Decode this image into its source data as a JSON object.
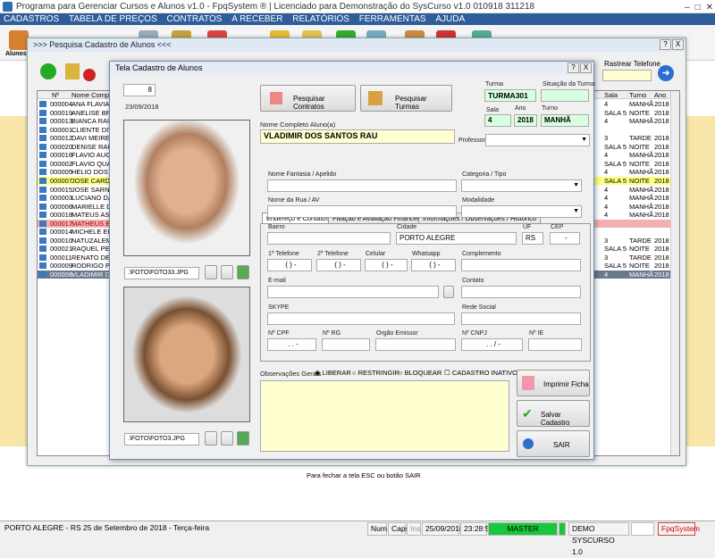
{
  "app": {
    "title": "Programa para Gerenciar Cursos e Alunos v1.0 - FpqSystem ® | Licenciado para Demonstração do SysCurso v1.0 010918 311218"
  },
  "menu": [
    "CADASTROS",
    "TABELA DE PREÇOS",
    "CONTRATOS",
    "A RECEBER",
    "RELATÓRIOS",
    "FERRAMENTAS",
    "AJUDA"
  ],
  "toolbar": {
    "alunos_label": "Alunos"
  },
  "search_window": {
    "title": ">>> Pesquisa Cadastro de Alunos <<<",
    "rastrear_label": "Rastrear Telefone",
    "help": "?",
    "close": "X",
    "col_no": "Nº",
    "col_nome": "Nome Completo",
    "col_sala": "Sala",
    "col_turno": "Turno",
    "col_ano": "Ano",
    "rows": [
      {
        "n": "000004",
        "nome": "ANA FLAVIA ME",
        "sala": "4",
        "turno": "MANHÃ",
        "ano": "2018"
      },
      {
        "n": "000019",
        "nome": "ANELISE BRAND",
        "sala": "SALA 5",
        "turno": "NOITE",
        "ano": "2018"
      },
      {
        "n": "000013",
        "nome": "BIANCA RAU",
        "sala": "4",
        "turno": "MANHÃ",
        "ano": "2018"
      },
      {
        "n": "000001",
        "nome": "CLIENTE DIVERS",
        "sala": "",
        "turno": "",
        "ano": ""
      },
      {
        "n": "000012",
        "nome": "DAVI MEIRELLE",
        "sala": "3",
        "turno": "TARDE",
        "ano": "2018"
      },
      {
        "n": "000020",
        "nome": "DENISE RAU DO",
        "sala": "SALA 5",
        "turno": "NOITE",
        "ano": "2018"
      },
      {
        "n": "000016",
        "nome": "FLAVIO AUGUST",
        "sala": "4",
        "turno": "MANHÃ",
        "ano": "2018"
      },
      {
        "n": "000002",
        "nome": "FLAVIO QUADRA",
        "sala": "SALA 5",
        "turno": "NOITE",
        "ano": "2018"
      },
      {
        "n": "000005",
        "nome": "HELIO DOS SAN",
        "sala": "4",
        "turno": "MANHÃ",
        "ano": "2018"
      },
      {
        "n": "000007",
        "nome": "JOSE CARDOSO",
        "sala": "SALA 5",
        "turno": "NOITE",
        "ano": "2018"
      },
      {
        "n": "000015",
        "nome": "JOSE SARNEY",
        "sala": "4",
        "turno": "MANHÃ",
        "ano": "2018"
      },
      {
        "n": "000003",
        "nome": "LUCIANO DA SIL",
        "sala": "4",
        "turno": "MANHÃ",
        "ano": "2018"
      },
      {
        "n": "000006",
        "nome": "MARIELLE DA S",
        "sala": "4",
        "turno": "MANHÃ",
        "ano": "2018"
      },
      {
        "n": "000018",
        "nome": "MATEUS ASSIS",
        "sala": "4",
        "turno": "MANHÃ",
        "ano": "2018"
      },
      {
        "n": "000017",
        "nome": "MATHEUS EILOF",
        "sala": "",
        "turno": "",
        "ano": ""
      },
      {
        "n": "000014",
        "nome": "MICHELE EILOF",
        "sala": "",
        "turno": "",
        "ano": ""
      },
      {
        "n": "000010",
        "nome": "NATUZALEM DE",
        "sala": "3",
        "turno": "TARDE",
        "ano": "2018"
      },
      {
        "n": "000021",
        "nome": "RAQUEL PEREIR",
        "sala": "SALA 5",
        "turno": "NOITE",
        "ano": "2018"
      },
      {
        "n": "000011",
        "nome": "RENATO DE OLI",
        "sala": "3",
        "turno": "TARDE",
        "ano": "2018"
      },
      {
        "n": "000009",
        "nome": "RODRIGO PEREI",
        "sala": "SALA 5",
        "turno": "NOITE",
        "ano": "2018"
      },
      {
        "n": "000008",
        "nome": "VLADIMIR DOS S",
        "sala": "4",
        "turno": "MANHÃ",
        "ano": "2018"
      }
    ],
    "footer": "Para fechar a tela ESC ou botão SAIR"
  },
  "form": {
    "title": "Tela Cadastro de Alunos",
    "help": "?",
    "close": "X",
    "id": "8",
    "date": "23/09/2018",
    "btn_contratos": "Pesquisar Contratos",
    "btn_turmas": "Pesquisar Turmas",
    "turma_label": "Turma",
    "turma": "TURMA301",
    "situacao_label": "Situação da Turma",
    "situacao": "",
    "sala_label": "Sala",
    "sala": "4",
    "ano_label": "Ano",
    "ano": "2018",
    "turno_label": "Turno",
    "turno": "MANHÃ",
    "nome_label": "Nome Completo Aluno(a)",
    "nome": "VLADIMIR DOS SANTOS RAU",
    "professor_label": "Professor",
    "tabs": [
      "Endereço e Contatos ->",
      "Filiação e Avaliação Financeira ->",
      "Informações / Observações / Histórico"
    ],
    "fantasia_label": "Nome Fantasia / Apelido",
    "categoria_label": "Categoria / Tipo",
    "rua_label": "Nome da Rua / AV",
    "modalidade_label": "Modalidade",
    "bairro_label": "Bairro",
    "cidade_label": "Cidade",
    "cidade": "PORTO ALEGRE",
    "uf_label": "UF",
    "uf": "RS",
    "cep_label": "CEP",
    "cep": "-",
    "tel1_label": "1º Telefone",
    "tel1": "( )  -",
    "tel2_label": "2º Telefone",
    "tel2": "( )  -",
    "cel_label": "Celular",
    "cel": "( )  -",
    "whats_label": "Whatsapp",
    "whats": "( )  -",
    "compl_label": "Complemento",
    "email_label": "E-mail",
    "contato_label": "Contato",
    "skype_label": "SKYPE",
    "rede_label": "Rede Social",
    "cpf_label": "Nº CPF",
    "cpf": ". . -",
    "rg_label": "Nº RG",
    "orgao_label": "Orgão Emissor",
    "cnpj_label": "Nº CNPJ",
    "cnpj": ". . / -",
    "ie_label": "Nº IE",
    "obs_label": "Observações Gerais",
    "liberar": "LIBERAR",
    "restringir": "RESTRINGIR",
    "bloquear": "BLOQUEAR",
    "inativo": "CADASTRO INATIVO",
    "photo1_path": ".\\FOTO\\FOTO33.JPG",
    "photo2_path": ".\\FOTO\\FOTO3.JPG",
    "btn_imprimir": "Imprimir Ficha",
    "btn_salvar": "Salvar Cadastro",
    "btn_sair": "SAIR"
  },
  "status": {
    "city_date": "PORTO ALEGRE - RS 25 de Setembro de 2018 - Terça-feira",
    "num": "Num",
    "caps": "Caps",
    "ins": "Ins",
    "date": "25/09/2018",
    "time": "23:28:58",
    "master": "MASTER",
    "demo": "DEMO SYSCURSO 1.0",
    "brand": "FpqSystem"
  }
}
